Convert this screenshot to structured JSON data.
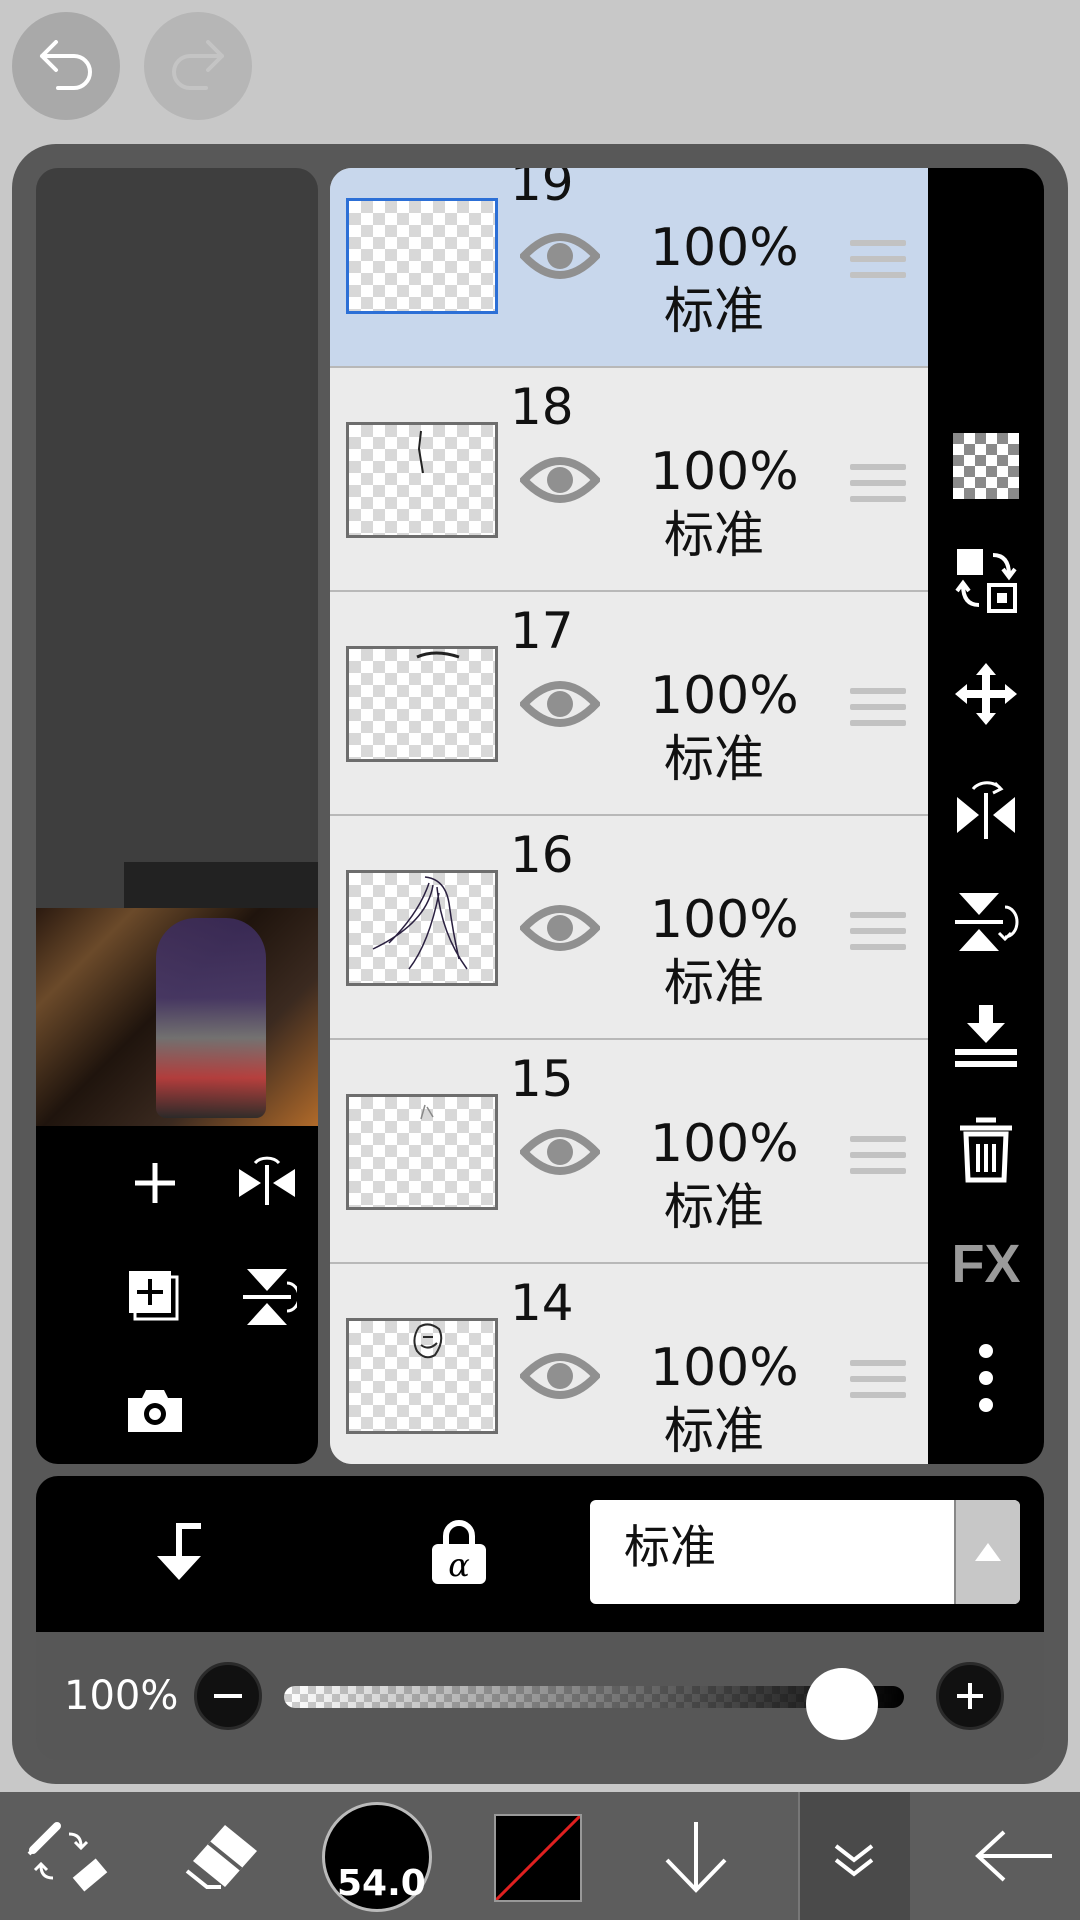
{
  "history": {
    "undo_icon": "undo-icon",
    "redo_icon": "redo-icon"
  },
  "layers": [
    {
      "number": "19",
      "opacity": "100%",
      "blend": "标准",
      "selected": true
    },
    {
      "number": "18",
      "opacity": "100%",
      "blend": "标准",
      "selected": false
    },
    {
      "number": "17",
      "opacity": "100%",
      "blend": "标准",
      "selected": false
    },
    {
      "number": "16",
      "opacity": "100%",
      "blend": "标准",
      "selected": false
    },
    {
      "number": "15",
      "opacity": "100%",
      "blend": "标准",
      "selected": false
    },
    {
      "number": "14",
      "opacity": "100%",
      "blend": "标准",
      "selected": false
    }
  ],
  "right_toolbar": {
    "fx_label": "FX"
  },
  "bottom_controls": {
    "blend_mode": "标准"
  },
  "opacity_slider": {
    "label": "100%",
    "value": 1.0
  },
  "app_bar": {
    "brush_size": "54.0"
  },
  "colors": {
    "selected_row": "#c8d7ec",
    "selected_thumb_border": "#2c6fd6",
    "panel": "#585858",
    "toolbar": "#000000",
    "app_bar": "#5d5d5d"
  }
}
